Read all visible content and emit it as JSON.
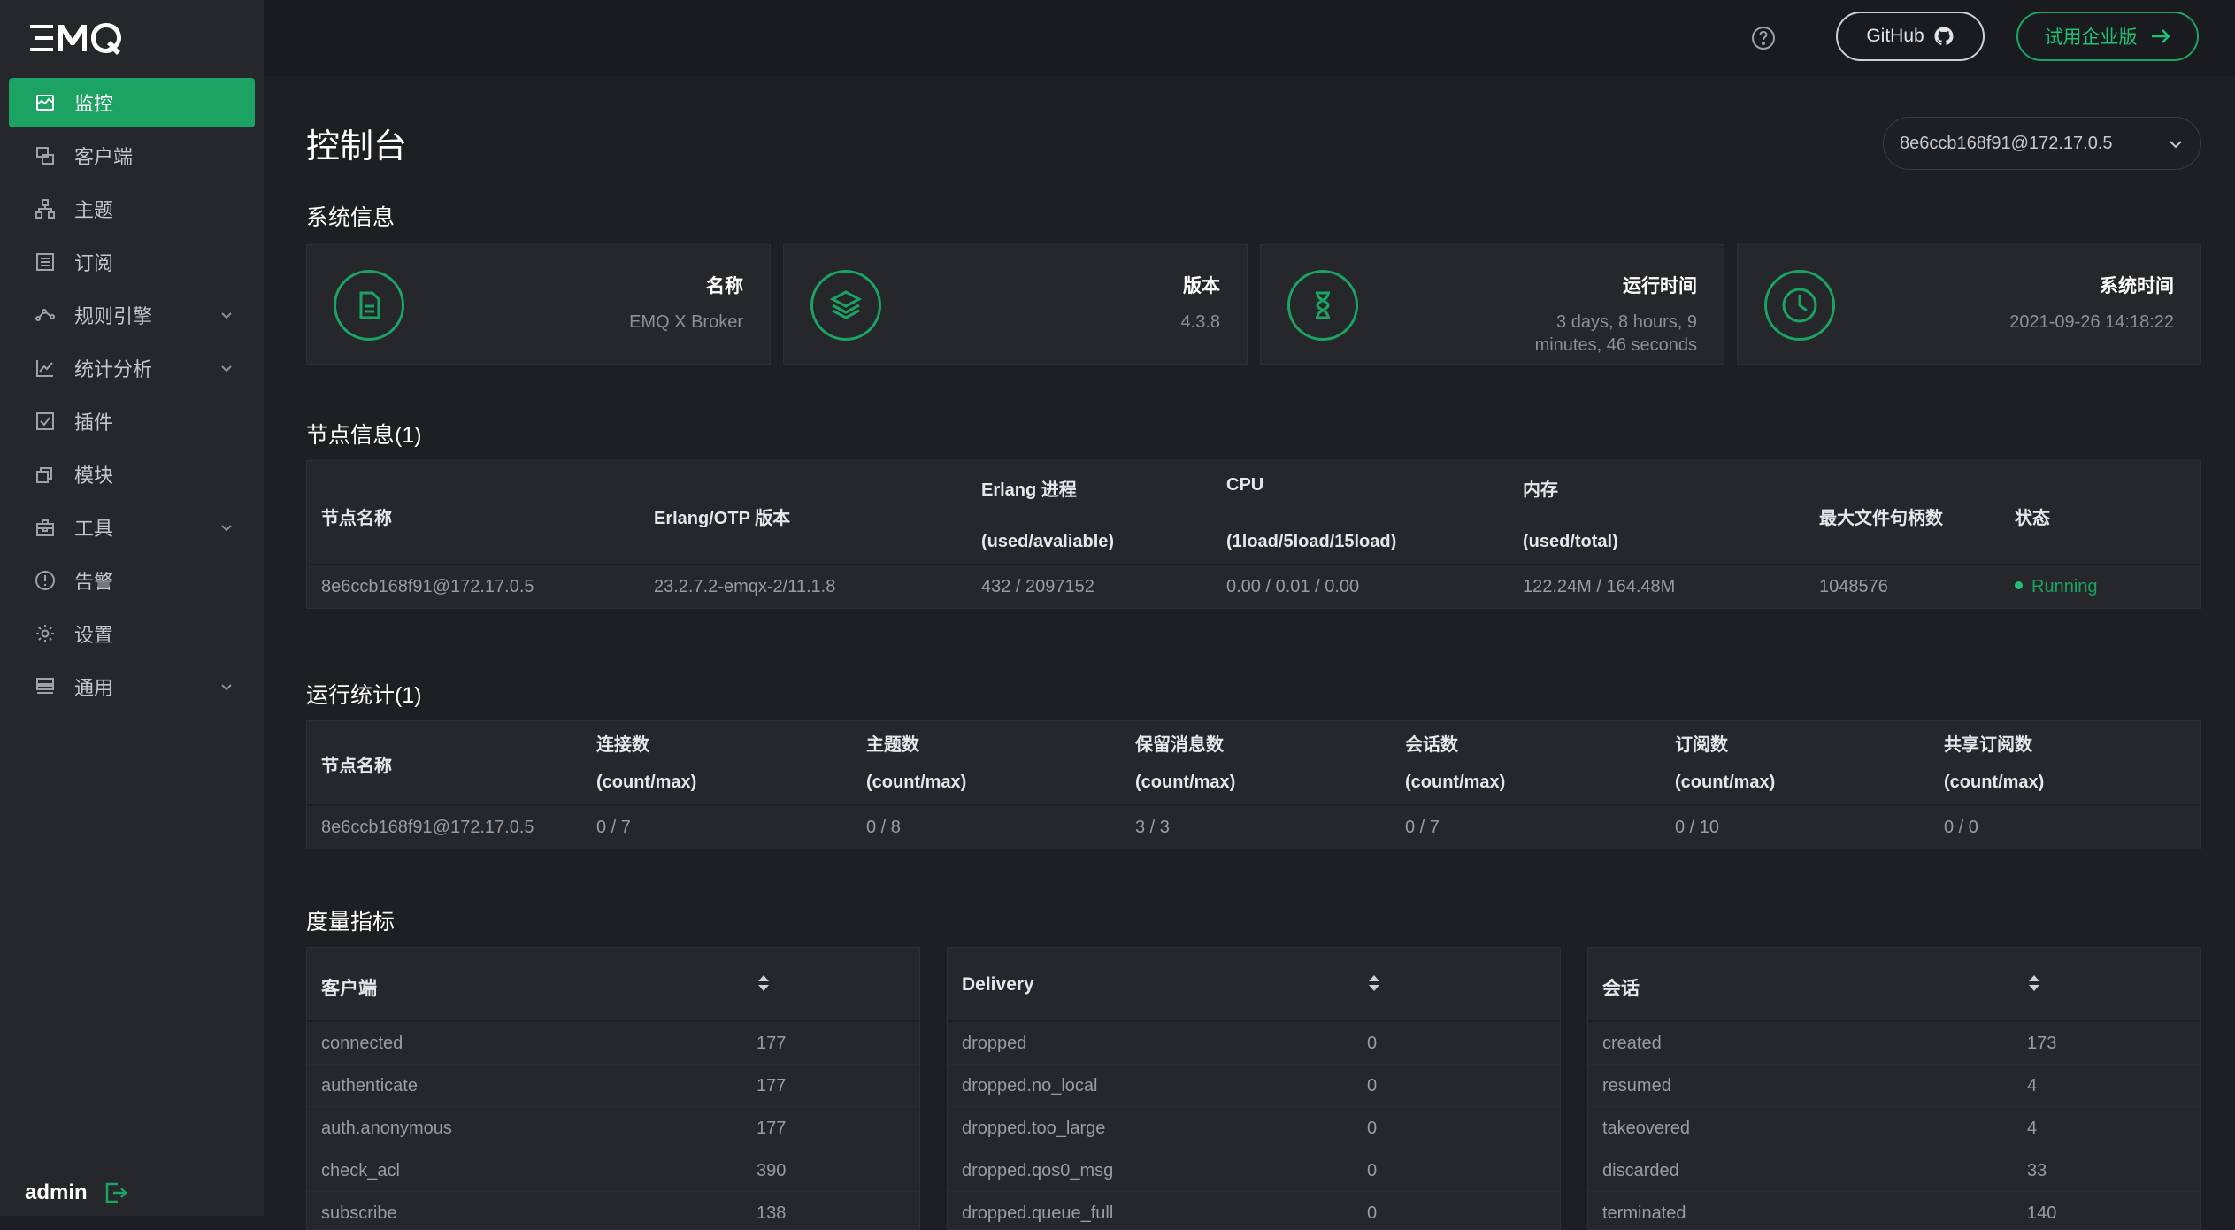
{
  "brand": {
    "logo_text": "EMQ"
  },
  "sidebar": {
    "items": [
      {
        "label": "监控",
        "icon": "monitor-icon",
        "active": true,
        "has_children": false
      },
      {
        "label": "客户端",
        "icon": "clients-icon",
        "active": false,
        "has_children": false
      },
      {
        "label": "主题",
        "icon": "topics-icon",
        "active": false,
        "has_children": false
      },
      {
        "label": "订阅",
        "icon": "subscriptions-icon",
        "active": false,
        "has_children": false
      },
      {
        "label": "规则引擎",
        "icon": "rule-engine-icon",
        "active": false,
        "has_children": true
      },
      {
        "label": "统计分析",
        "icon": "analytics-icon",
        "active": false,
        "has_children": true
      },
      {
        "label": "插件",
        "icon": "plugins-icon",
        "active": false,
        "has_children": false
      },
      {
        "label": "模块",
        "icon": "modules-icon",
        "active": false,
        "has_children": false
      },
      {
        "label": "工具",
        "icon": "tools-icon",
        "active": false,
        "has_children": true
      },
      {
        "label": "告警",
        "icon": "alarm-icon",
        "active": false,
        "has_children": false
      },
      {
        "label": "设置",
        "icon": "settings-icon",
        "active": false,
        "has_children": false
      },
      {
        "label": "通用",
        "icon": "general-icon",
        "active": false,
        "has_children": true
      }
    ],
    "user": "admin"
  },
  "header": {
    "github_label": "GitHub",
    "trial_label": "试用企业版"
  },
  "page": {
    "title": "控制台",
    "node_selector": "8e6ccb168f91@172.17.0.5"
  },
  "system_info": {
    "title": "系统信息",
    "cards": [
      {
        "label": "名称",
        "value": "EMQ X Broker",
        "icon": "file-icon"
      },
      {
        "label": "版本",
        "value": "4.3.8",
        "icon": "layers-icon"
      },
      {
        "label": "运行时间",
        "value": "3 days, 8 hours, 9 minutes, 46 seconds",
        "icon": "hourglass-icon"
      },
      {
        "label": "系统时间",
        "value": "2021-09-26 14:18:22",
        "icon": "clock-icon"
      }
    ]
  },
  "node_info": {
    "title": "节点信息(1)",
    "headers": {
      "name": "节点名称",
      "otp": "Erlang/OTP 版本",
      "process": "Erlang 进程",
      "process_sub": "(used/avaliable)",
      "cpu": "CPU",
      "cpu_sub": "(1load/5load/15load)",
      "memory": "内存",
      "memory_sub": "(used/total)",
      "max_fds": "最大文件句柄数",
      "status": "状态"
    },
    "rows": [
      {
        "name": "8e6ccb168f91@172.17.0.5",
        "otp": "23.2.7.2-emqx-2/11.1.8",
        "process": "432 / 2097152",
        "cpu": "0.00 / 0.01 / 0.00",
        "memory": "122.24M / 164.48M",
        "max_fds": "1048576",
        "status": "Running"
      }
    ]
  },
  "stats": {
    "title": "运行统计(1)",
    "headers": {
      "name": "节点名称",
      "connections": "连接数",
      "topics": "主题数",
      "retained": "保留消息数",
      "sessions": "会话数",
      "subscriptions": "订阅数",
      "shared": "共享订阅数",
      "sub": "(count/max)"
    },
    "rows": [
      {
        "name": "8e6ccb168f91@172.17.0.5",
        "connections": "0 / 7",
        "topics": "0 / 8",
        "retained": "3 / 3",
        "sessions": "0 / 7",
        "subscriptions": "0 / 10",
        "shared": "0 / 0"
      }
    ]
  },
  "metrics": {
    "title": "度量指标",
    "panels": [
      {
        "title": "客户端",
        "rows": [
          {
            "k": "connected",
            "v": "177"
          },
          {
            "k": "authenticate",
            "v": "177"
          },
          {
            "k": "auth.anonymous",
            "v": "177"
          },
          {
            "k": "check_acl",
            "v": "390"
          },
          {
            "k": "subscribe",
            "v": "138"
          }
        ]
      },
      {
        "title": "Delivery",
        "rows": [
          {
            "k": "dropped",
            "v": "0"
          },
          {
            "k": "dropped.no_local",
            "v": "0"
          },
          {
            "k": "dropped.too_large",
            "v": "0"
          },
          {
            "k": "dropped.qos0_msg",
            "v": "0"
          },
          {
            "k": "dropped.queue_full",
            "v": "0"
          }
        ]
      },
      {
        "title": "会话",
        "rows": [
          {
            "k": "created",
            "v": "173"
          },
          {
            "k": "resumed",
            "v": "4"
          },
          {
            "k": "takeovered",
            "v": "4"
          },
          {
            "k": "discarded",
            "v": "33"
          },
          {
            "k": "terminated",
            "v": "140"
          }
        ]
      }
    ]
  },
  "colors": {
    "accent": "#1aa363",
    "background": "#1e1f22",
    "panel": "#26272b"
  }
}
